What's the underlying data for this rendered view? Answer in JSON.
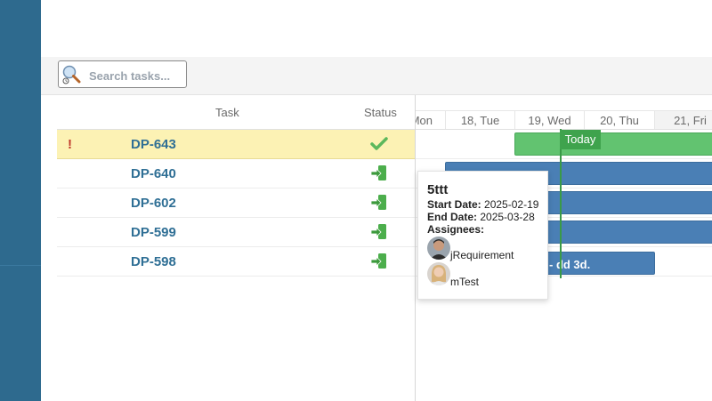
{
  "search": {
    "placeholder": "Search tasks..."
  },
  "grid": {
    "columns": {
      "task": "Task",
      "status": "Status"
    },
    "rows": [
      {
        "id": "DP-643",
        "priority_flag": "!",
        "status_icon": "check-icon",
        "highlighted": true
      },
      {
        "id": "DP-640",
        "priority_flag": "",
        "status_icon": "move-in-icon",
        "highlighted": false
      },
      {
        "id": "DP-602",
        "priority_flag": "",
        "status_icon": "move-in-icon",
        "highlighted": false
      },
      {
        "id": "DP-599",
        "priority_flag": "",
        "status_icon": "move-in-icon",
        "highlighted": false
      },
      {
        "id": "DP-598",
        "priority_flag": "",
        "status_icon": "move-in-icon",
        "highlighted": false
      }
    ]
  },
  "timeline": {
    "days": [
      "Mon",
      "18, Tue",
      "19, Wed",
      "20, Thu",
      "21, Fri"
    ],
    "today_label": "Today",
    "bar_label_fragment": "- dd 3d."
  },
  "tooltip": {
    "title": "5ttt",
    "start_label": "Start Date:",
    "start_value": "2025-02-19",
    "end_label": "End Date:",
    "end_value": "2025-03-28",
    "assignees_label": "Assignees:",
    "assignees": [
      "jRequirement",
      "mTest"
    ]
  },
  "colors": {
    "side_rail": "#2e6a8e",
    "task_id": "#2f6f95",
    "highlight_row": "#fcf2b4",
    "bar_green": "#62c370",
    "bar_blue": "#4a7fb5",
    "today": "#3fa34d"
  }
}
